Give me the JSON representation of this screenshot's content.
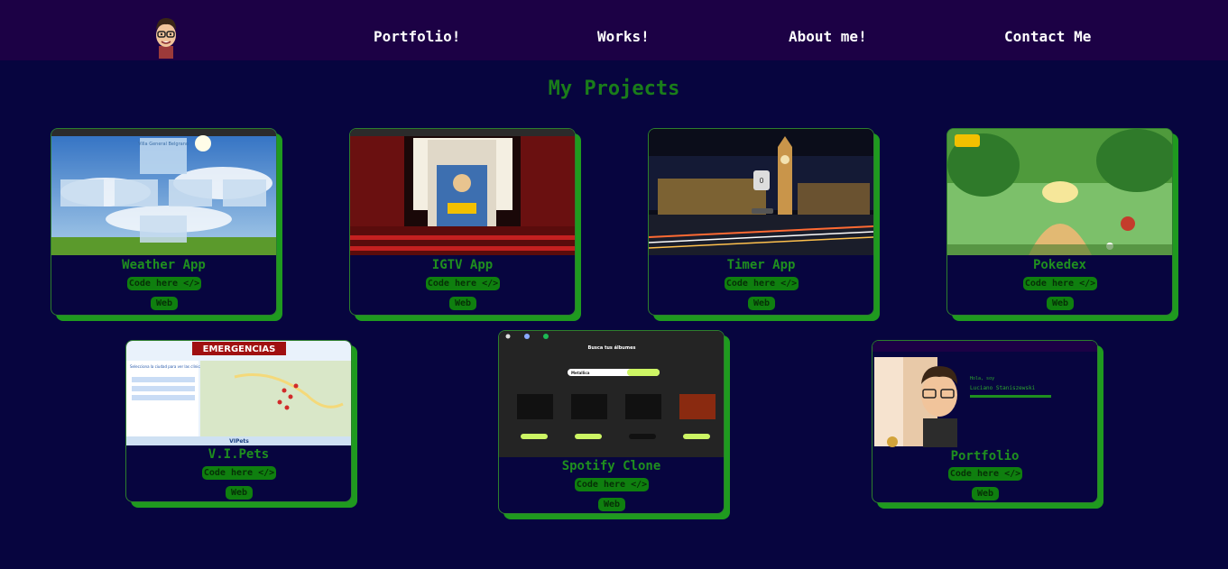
{
  "nav": {
    "links": [
      "Portfolio!",
      "Works!",
      "About me!",
      "Contact Me"
    ]
  },
  "page": {
    "title": "My Projects"
  },
  "projects": [
    {
      "title": "Weather App",
      "code_label": "Code here </>",
      "web_label": "Web"
    },
    {
      "title": "IGTV App",
      "code_label": "Code here </>",
      "web_label": "Web"
    },
    {
      "title": "Timer App",
      "code_label": "Code here </>",
      "web_label": "Web"
    },
    {
      "title": "Pokedex",
      "code_label": "Code here </>",
      "web_label": "Web"
    },
    {
      "title": "V.I.Pets",
      "code_label": "Code here </>",
      "web_label": "Web"
    },
    {
      "title": "Spotify Clone",
      "code_label": "Code here </>",
      "web_label": "Web"
    },
    {
      "title": "Portfolio",
      "code_label": "Code here </>",
      "web_label": "Web"
    }
  ],
  "thumb_text": {
    "weather_city": "Villa General Belgrano",
    "emergency_banner": "EMERGENCIAS",
    "emergency_subtitle": "Selecciona la ciudad para ver las clínicas 24h",
    "emergency_logo": "VIPets",
    "spotify_heading": "Busca tus álbumes",
    "spotify_search": "Metallica",
    "timer_value": "0",
    "portfolio_greeting": "Hola, soy",
    "portfolio_name": "Luciano Staniszewski"
  },
  "colors": {
    "background": "#07053f",
    "navbar": "#1c0145",
    "accent_green": "#1f8f1f",
    "shadow_green": "#1f9a1f"
  },
  "icons": {
    "avatar": "bitmoji-avatar",
    "code": "code-brackets"
  }
}
